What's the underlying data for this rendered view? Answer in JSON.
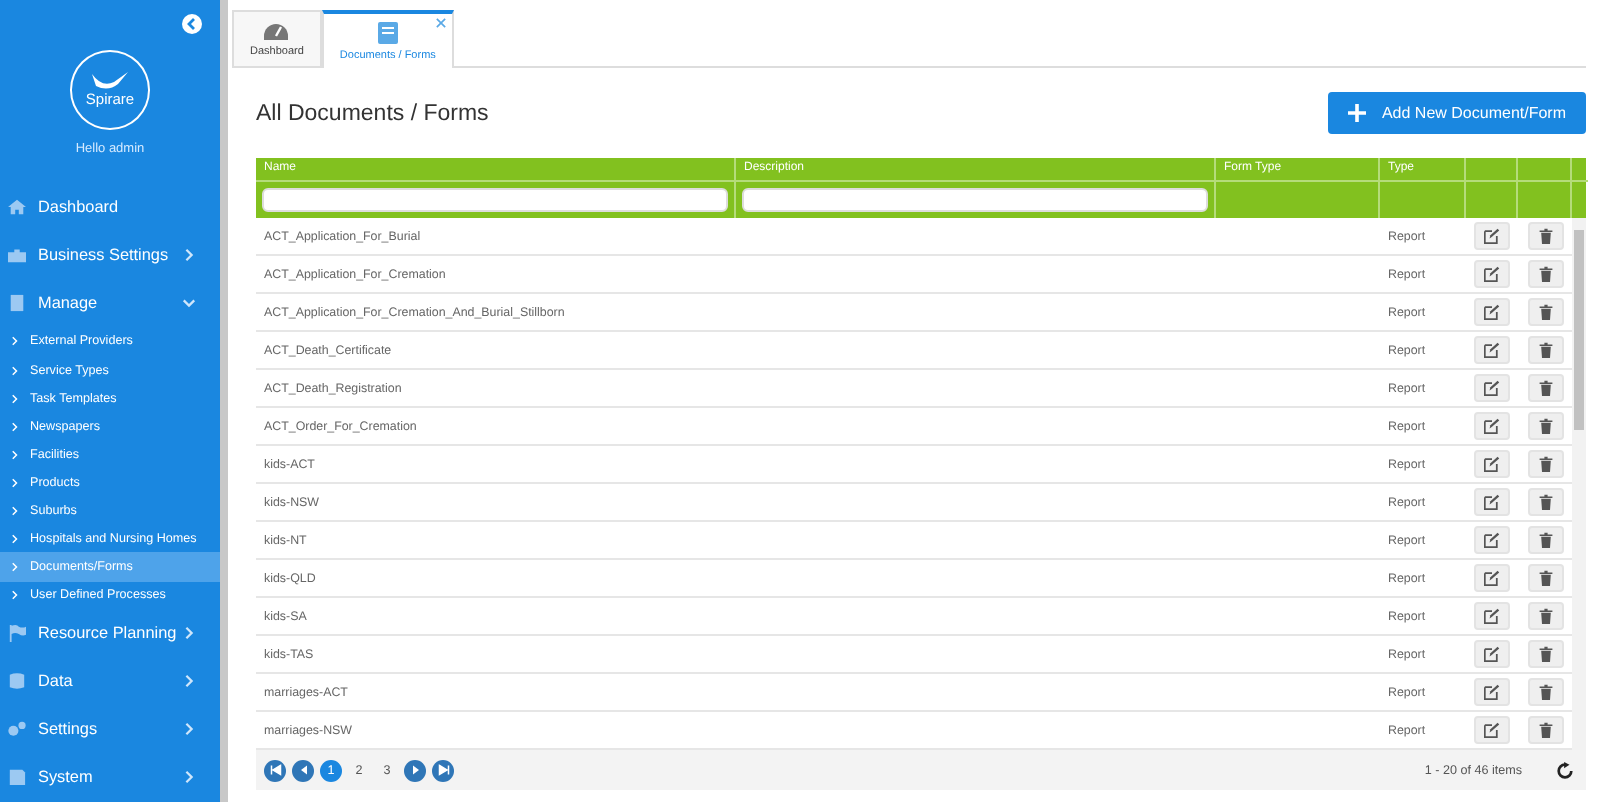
{
  "sidebar": {
    "logo": "Spirare",
    "greeting": "Hello admin",
    "nav": [
      {
        "label": "Dashboard",
        "kind": "link"
      },
      {
        "label": "Business Settings",
        "kind": "group",
        "expanded": false
      },
      {
        "label": "Manage",
        "kind": "group",
        "expanded": true,
        "children": [
          {
            "label": "External Providers",
            "selected": false
          },
          {
            "label": "Service Types",
            "selected": false
          },
          {
            "label": "Task Templates",
            "selected": false
          },
          {
            "label": "Newspapers",
            "selected": false
          },
          {
            "label": "Facilities",
            "selected": false
          },
          {
            "label": "Products",
            "selected": false
          },
          {
            "label": "Suburbs",
            "selected": false
          },
          {
            "label": "Hospitals and Nursing Homes",
            "selected": false
          },
          {
            "label": "Documents/Forms",
            "selected": true
          },
          {
            "label": "User Defined Processes",
            "selected": false
          }
        ]
      },
      {
        "label": "Resource Planning",
        "kind": "group",
        "expanded": false
      },
      {
        "label": "Data",
        "kind": "group",
        "expanded": false
      },
      {
        "label": "Settings",
        "kind": "group",
        "expanded": false
      },
      {
        "label": "System",
        "kind": "group",
        "expanded": false
      }
    ]
  },
  "tabs": [
    {
      "label": "Dashboard",
      "selected": false,
      "closable": false
    },
    {
      "label": "Documents / Forms",
      "selected": true,
      "closable": true
    }
  ],
  "page_title": "All Documents / Forms",
  "add_button": "Add New Document/Form",
  "table": {
    "columns": [
      "Name",
      "Description",
      "Form Type",
      "Type"
    ],
    "rows": [
      {
        "name": "ACT_Application_For_Burial",
        "type": "Report"
      },
      {
        "name": "ACT_Application_For_Cremation",
        "type": "Report"
      },
      {
        "name": "ACT_Application_For_Cremation_And_Burial_Stillborn",
        "type": "Report"
      },
      {
        "name": "ACT_Death_Certificate",
        "type": "Report"
      },
      {
        "name": "ACT_Death_Registration",
        "type": "Report"
      },
      {
        "name": "ACT_Order_For_Cremation",
        "type": "Report"
      },
      {
        "name": "kids-ACT",
        "type": "Report"
      },
      {
        "name": "kids-NSW",
        "type": "Report"
      },
      {
        "name": "kids-NT",
        "type": "Report"
      },
      {
        "name": "kids-QLD",
        "type": "Report"
      },
      {
        "name": "kids-SA",
        "type": "Report"
      },
      {
        "name": "kids-TAS",
        "type": "Report"
      },
      {
        "name": "marriages-ACT",
        "type": "Report"
      },
      {
        "name": "marriages-NSW",
        "type": "Report"
      }
    ]
  },
  "pager": {
    "pages": [
      {
        "label": "1",
        "selected": true
      },
      {
        "label": "2",
        "selected": false
      },
      {
        "label": "3",
        "selected": false
      }
    ],
    "info": "1 - 20 of 46 items"
  }
}
